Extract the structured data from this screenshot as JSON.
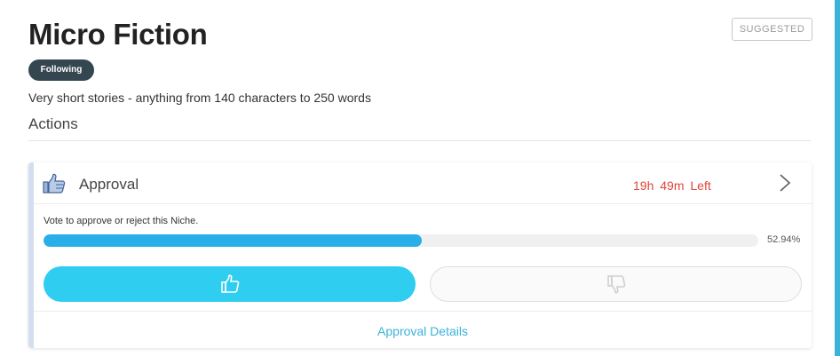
{
  "niche": {
    "title": "Micro Fiction",
    "badge": "SUGGESTED",
    "follow_label": "Following",
    "description": "Very short stories - anything from 140 characters to 250 words"
  },
  "actions": {
    "heading": "Actions"
  },
  "approval_card": {
    "title": "Approval",
    "time_left": "19h 49m Left",
    "vote_prompt": "Vote to approve or reject this Niche.",
    "progress_percent": 52.94,
    "progress_label": "52.94%",
    "approve_icon": "thumbs-up-icon",
    "reject_icon": "thumbs-down-icon",
    "details_link": "Approval Details"
  },
  "colors": {
    "accent": "#2fcdf0",
    "progress": "#2aaee9",
    "timer": "#e0453a",
    "following_bg": "#34464f",
    "link": "#3bb3d9"
  }
}
